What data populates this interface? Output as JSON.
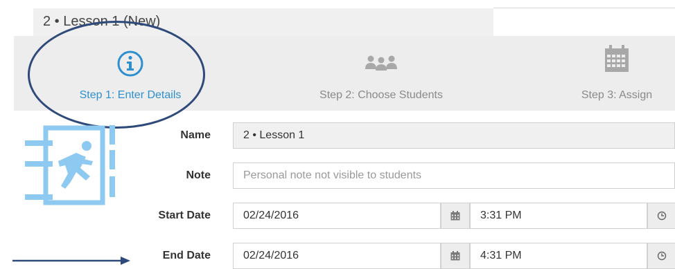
{
  "header": {
    "title": "2 • Lesson 1 (New)"
  },
  "steps": [
    {
      "label": "Step 1: Enter Details",
      "icon": "info-icon",
      "active": true
    },
    {
      "label": "Step 2: Choose Students",
      "icon": "people-icon",
      "active": false
    },
    {
      "label": "Step 3: Assign",
      "icon": "calendar-icon",
      "active": false
    }
  ],
  "form": {
    "name": {
      "label": "Name",
      "value": "2 • Lesson 1"
    },
    "note": {
      "label": "Note",
      "placeholder": "Personal note not visible to students",
      "value": ""
    },
    "start": {
      "label": "Start Date",
      "date": "02/24/2016",
      "time": "3:31 PM"
    },
    "end": {
      "label": "End Date",
      "date": "02/24/2016",
      "time": "4:31 PM"
    }
  },
  "colors": {
    "accent": "#2e8fd0",
    "annotation": "#2d4a7a",
    "icon_light": "#8ec9f2",
    "inactive": "#8a8a8a"
  }
}
